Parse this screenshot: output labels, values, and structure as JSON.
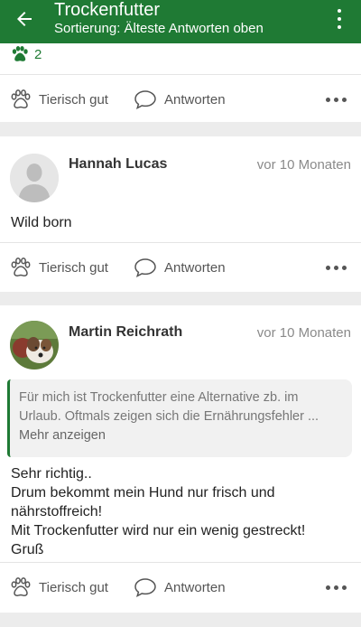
{
  "header": {
    "title": "Trockenfutter",
    "subtitle": "Sortierung: Älteste Antworten oben"
  },
  "first_post": {
    "paw_count": "2"
  },
  "actions": {
    "like_label": "Tierisch gut",
    "reply_label": "Antworten"
  },
  "posts": [
    {
      "author": "Hannah Lucas",
      "time": "vor 10 Monaten",
      "text": "Wild born"
    },
    {
      "author": "Martin Reichrath",
      "time": "vor 10 Monaten",
      "quote": {
        "line1": "Für mich ist Trockenfutter eine Alternative zb. im",
        "line2": "Urlaub. Oftmals zeigen sich die Ernährungsfehler ...",
        "more_label": "Mehr anzeigen"
      },
      "lines": [
        "Sehr richtig..",
        "Drum bekommt mein Hund nur frisch und",
        "nährstoffreich!",
        "Mit Trockenfutter wird nur ein wenig gestreckt!",
        "Gruß"
      ]
    }
  ],
  "colors": {
    "brand": "#1f7a34",
    "background": "#ececec"
  }
}
